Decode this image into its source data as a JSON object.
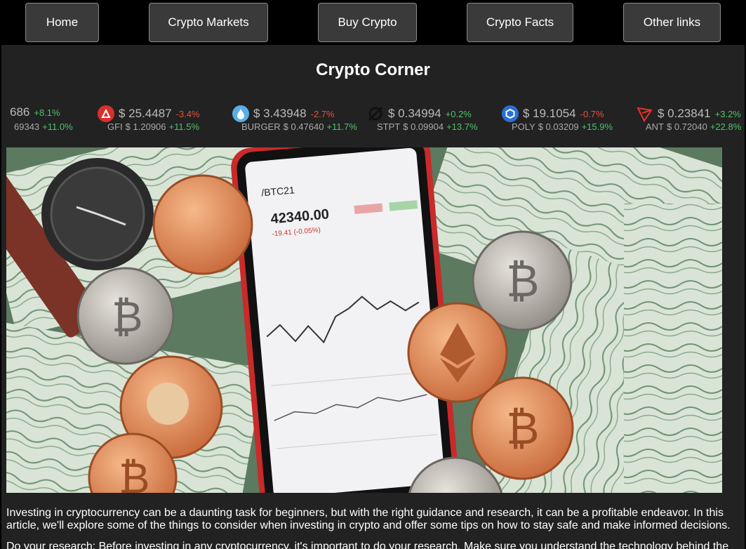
{
  "nav": {
    "items": [
      {
        "label": "Home"
      },
      {
        "label": "Crypto Markets"
      },
      {
        "label": "Buy Crypto"
      },
      {
        "label": "Crypto Facts"
      },
      {
        "label": "Other links"
      }
    ]
  },
  "page": {
    "title": "Crypto Corner"
  },
  "ticker": {
    "items": [
      {
        "icon": "",
        "price": "686",
        "change": "+8.1%",
        "dir": "pos",
        "sub_symbol": "",
        "sub_price": "69343",
        "sub_change": "+11.0%"
      },
      {
        "icon": "gfi-icon",
        "price": "$ 25.4487",
        "change": "-3.4%",
        "dir": "neg",
        "sub_symbol": "GFI",
        "sub_price": "$ 1.20906",
        "sub_change": "+11.5%"
      },
      {
        "icon": "burger-icon",
        "price": "$ 3.43948",
        "change": "-2.7%",
        "dir": "neg",
        "sub_symbol": "BURGER",
        "sub_price": "$ 0.47640",
        "sub_change": "+11.7%"
      },
      {
        "icon": "stpt-icon",
        "price": "$ 0.34994",
        "change": "+0.2%",
        "dir": "pos",
        "sub_symbol": "STPT",
        "sub_price": "$ 0.09904",
        "sub_change": "+13.7%"
      },
      {
        "icon": "poly-icon",
        "price": "$ 19.1054",
        "change": "-0.7%",
        "dir": "neg",
        "sub_symbol": "POLY",
        "sub_price": "$ 0.03209",
        "sub_change": "+15.9%"
      },
      {
        "icon": "tron-icon",
        "price": "$ 0.23841",
        "change": "+3.2%",
        "dir": "pos",
        "sub_symbol": "ANT",
        "sub_price": "$ 0.72040",
        "sub_change": "+22.8%"
      }
    ]
  },
  "hero": {
    "phone_symbol": "/BTC21",
    "phone_price": "42340.00",
    "phone_change": "-19.41 (-0.05%)"
  },
  "article": {
    "p1": "Investing in cryptocurrency can be a daunting task for beginners, but with the right guidance and research, it can be a profitable endeavor. In this article, we'll explore some of the things to consider when investing in crypto and offer some tips on how to stay safe and make informed decisions.",
    "p2": "Do your research: Before investing in any cryptocurrency, it's important to do your research. Make sure you understand the technology behind the"
  }
}
